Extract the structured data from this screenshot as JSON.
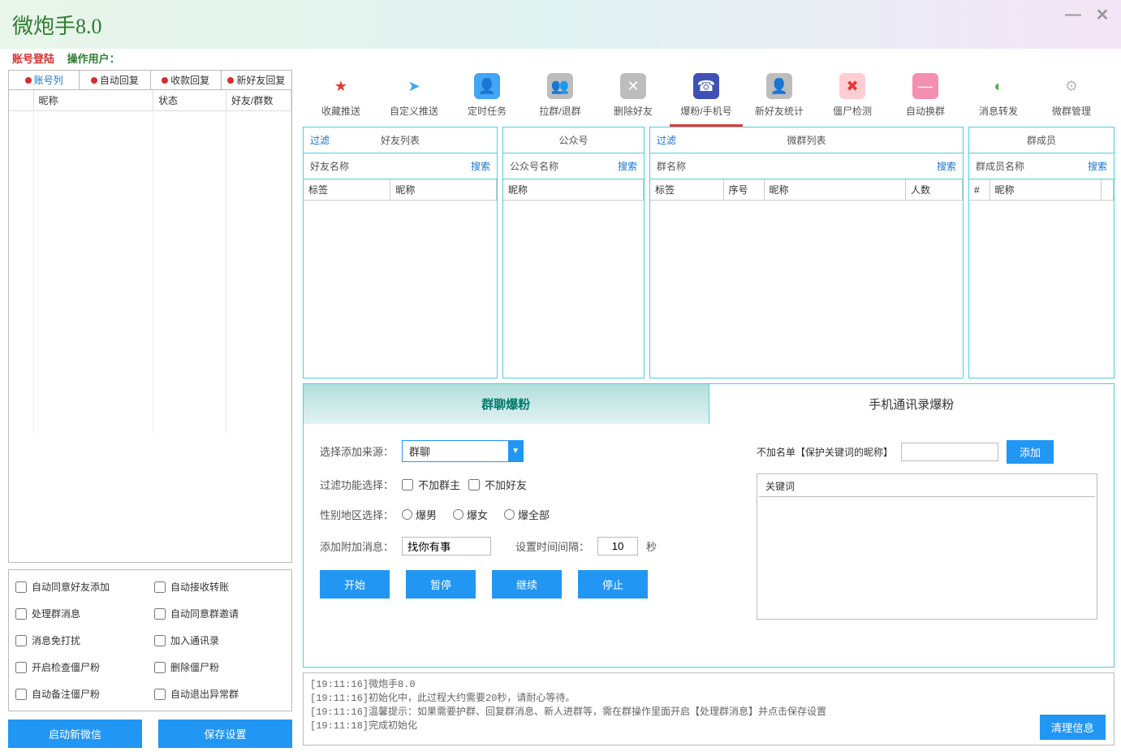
{
  "app": {
    "title": "微炮手8.0"
  },
  "login": {
    "label": "账号登陆",
    "user_label": "操作用户："
  },
  "left": {
    "tabs": [
      "账号列",
      "自动回复",
      "收款回复",
      "新好友回复"
    ],
    "cols": [
      "",
      "昵称",
      "状态",
      "好友/群数"
    ],
    "checks": [
      "自动同意好友添加",
      "自动接收转账",
      "处理群消息",
      "自动同意群邀请",
      "消息免打扰",
      "加入通讯录",
      "开启检查僵尸粉",
      "删除僵尸粉",
      "自动备注僵尸粉",
      "自动退出异常群"
    ],
    "btns": {
      "start": "启动新微信",
      "save": "保存设置"
    }
  },
  "toolbar": [
    {
      "label": "收藏推送",
      "bg": "#fff",
      "fg": "#e53935",
      "icon": "★"
    },
    {
      "label": "自定义推送",
      "bg": "#fff",
      "fg": "#42a5f5",
      "icon": "➤"
    },
    {
      "label": "定时任务",
      "bg": "#42a5f5",
      "fg": "#fff",
      "icon": "👤"
    },
    {
      "label": "拉群/退群",
      "bg": "#bdbdbd",
      "fg": "#fff",
      "icon": "👥"
    },
    {
      "label": "删除好友",
      "bg": "#bdbdbd",
      "fg": "#fff",
      "icon": "✕"
    },
    {
      "label": "爆粉/手机号",
      "bg": "#3f51b5",
      "fg": "#fff",
      "icon": "☎"
    },
    {
      "label": "新好友统计",
      "bg": "#bdbdbd",
      "fg": "#fff",
      "icon": "👤"
    },
    {
      "label": "僵尸检测",
      "bg": "#ffcdd2",
      "fg": "#e53935",
      "icon": "✖"
    },
    {
      "label": "自动换群",
      "bg": "#f48fb1",
      "fg": "#fff",
      "icon": "—"
    },
    {
      "label": "消息转发",
      "bg": "#fff",
      "fg": "#4caf50",
      "icon": "◐"
    },
    {
      "label": "微群管理",
      "bg": "#fff",
      "fg": "#bdbdbd",
      "icon": "⚙"
    }
  ],
  "panels": {
    "p1": {
      "filter": "过滤",
      "title": "好友列表",
      "search_label": "好友名称",
      "search": "搜索",
      "cols": [
        "标签",
        "昵称"
      ]
    },
    "p2": {
      "title": "公众号",
      "search_label": "公众号名称",
      "search": "搜索",
      "cols": [
        "昵称"
      ]
    },
    "p3": {
      "filter": "过滤",
      "title": "微群列表",
      "search_label": "群名称",
      "search": "搜索",
      "cols": [
        "标签",
        "序号",
        "昵称",
        "人数"
      ]
    },
    "p4": {
      "title": "群成员",
      "search_label": "群成员名称",
      "search": "搜索",
      "cols": [
        "#",
        "昵称",
        ""
      ]
    }
  },
  "cfg": {
    "tabs": [
      "群聊爆粉",
      "手机通讯录爆粉"
    ],
    "source_label": "选择添加来源：",
    "source_value": "群聊",
    "filter_label": "过滤功能选择：",
    "filter_opts": [
      "不加群主",
      "不加好友"
    ],
    "gender_label": "性别地区选择：",
    "gender_opts": [
      "爆男",
      "爆女",
      "爆全部"
    ],
    "msg_label": "添加附加消息：",
    "msg_value": "找你有事",
    "interval_label": "设置时间间隔：",
    "interval_value": "10",
    "interval_unit": "秒",
    "btns": [
      "开始",
      "暂停",
      "继续",
      "停止"
    ],
    "bl_label": "不加名单【保护关键词的昵称】",
    "bl_add": "添加",
    "bl_col": "关键词"
  },
  "log": [
    "[19:11:16]微炮手8.0",
    "[19:11:16]初始化中，此过程大约需要20秒，请耐心等待。",
    "[19:11:16]温馨提示：如果需要护群、回复群消息、新人进群等，需在群操作里面开启【处理群消息】并点击保存设置",
    "[19:11:18]完成初始化"
  ],
  "clear_log": "清理信息"
}
